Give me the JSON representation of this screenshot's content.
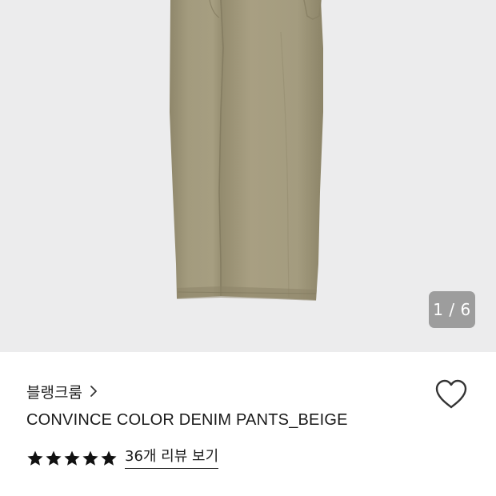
{
  "gallery": {
    "image_alt": "product-photo",
    "counter_current": "1",
    "counter_separator": "/",
    "counter_total": "6",
    "counter_text": "1 / 6"
  },
  "product": {
    "brand": "블랭크룸",
    "title": "CONVINCE COLOR DENIM PANTS_BEIGE",
    "rating_stars": 5,
    "review_link": "36개 리뷰 보기"
  },
  "colors": {
    "background_gallery": "#ececed",
    "pants": "#a29a7c",
    "star": "#111111",
    "counter_bg": "#7a7a7a"
  },
  "icons": {
    "brand_chevron": "chevron-right-icon",
    "like": "heart-outline-icon",
    "star": "star-filled-icon"
  }
}
